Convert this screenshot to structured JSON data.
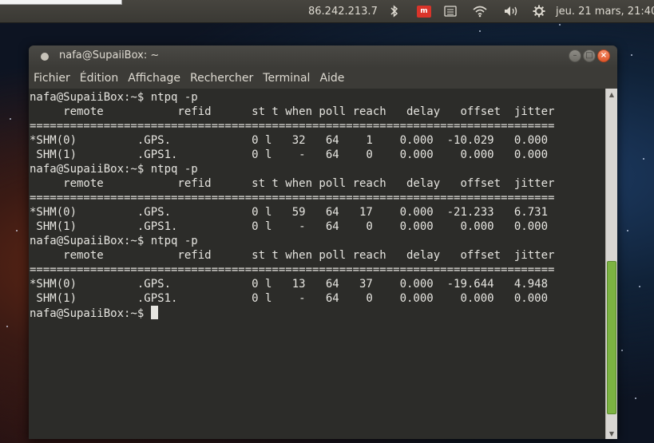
{
  "top_panel": {
    "ip_address": "86.242.213.7",
    "bluetooth_icon": "bluetooth-icon",
    "mail_icon": "mail-indicator-icon",
    "keyboard_icon": "keyboard-icon",
    "wifi_icon": "wifi-icon",
    "volume_icon": "volume-icon",
    "settings_icon": "gear-icon",
    "clock": "jeu. 21 mars, 21:40"
  },
  "window": {
    "title": "nafa@SupaiiBox: ~",
    "menu": [
      "Fichier",
      "Édition",
      "Affichage",
      "Rechercher",
      "Terminal",
      "Aide"
    ]
  },
  "terminal": {
    "lines": [
      "nafa@SupaiiBox:~$ ntpq -p",
      "     remote           refid      st t when poll reach   delay   offset  jitter",
      "==============================================================================",
      "*SHM(0)         .GPS.            0 l   32   64    1    0.000  -10.029   0.000",
      " SHM(1)         .GPS1.           0 l    -   64    0    0.000    0.000   0.000",
      "nafa@SupaiiBox:~$ ntpq -p",
      "     remote           refid      st t when poll reach   delay   offset  jitter",
      "==============================================================================",
      "*SHM(0)         .GPS.            0 l   59   64   17    0.000  -21.233   6.731",
      " SHM(1)         .GPS1.           0 l    -   64    0    0.000    0.000   0.000",
      "nafa@SupaiiBox:~$ ntpq -p",
      "     remote           refid      st t when poll reach   delay   offset  jitter",
      "==============================================================================",
      "*SHM(0)         .GPS.            0 l   13   64   37    0.000  -19.644   4.948",
      " SHM(1)         .GPS1.           0 l    -   64    0    0.000    0.000   0.000"
    ],
    "prompt": "nafa@SupaiiBox:~$ "
  }
}
